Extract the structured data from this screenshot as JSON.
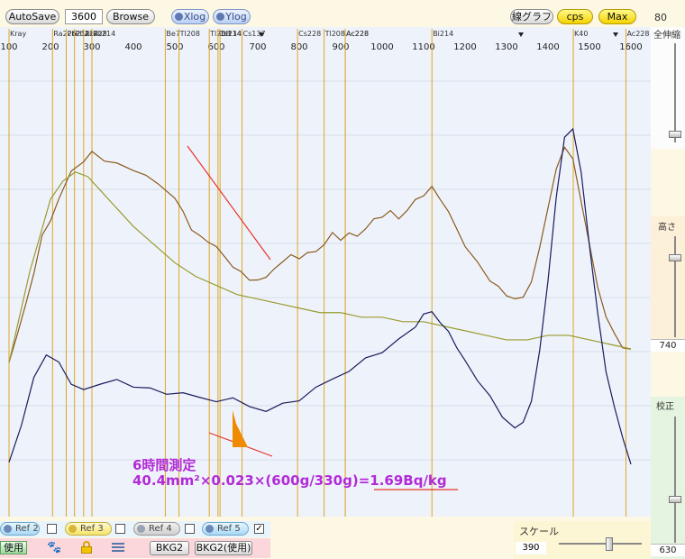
{
  "toolbar": {
    "autosave_label": "AutoSave",
    "measure_seconds": "3600",
    "browse_label": "Browse",
    "xlog_label": "Xlog",
    "ylog_label": "Ylog",
    "linear_graph_label": "線グラフ",
    "cps_label": "cps",
    "max_label": "Max",
    "max_value": "80"
  },
  "right_panel": {
    "zoom_all_label": "全伸縮",
    "height_label": "高さ",
    "height_value": "740",
    "calib_label": "校正",
    "calib_value": "630"
  },
  "bottom": {
    "ref2": "Ref 2",
    "ref3": "Ref 3",
    "ref4": "Ref 4",
    "ref5": "Ref 5",
    "ref5_checked": "✓",
    "use_label": "使用",
    "bkg2_label": "BKG2",
    "bkg2_use_label": "BKG2(使用)",
    "scale_label": "スケール",
    "scale_value": "390"
  },
  "chart_data": {
    "type": "line",
    "x_axis": {
      "min": 100,
      "max": 1600,
      "ticks": [
        100,
        200,
        300,
        400,
        500,
        600,
        700,
        800,
        900,
        1000,
        1100,
        1200,
        1300,
        1400,
        1500,
        1600
      ]
    },
    "nuclide_labels": [
      "Kray",
      "Ra226",
      "Pb212",
      "Pb214",
      "Ac228",
      "Pb214",
      "Be7",
      "Tl208",
      "Tl208",
      "Bi214",
      "Cs134",
      "Cs137",
      "Cs228",
      "Ac228",
      "Tl208",
      "Ac228",
      "Bi214",
      "K40",
      "Ac228"
    ],
    "series": [
      {
        "color": "#8b5a1e",
        "x": [
          100,
          120,
          140,
          160,
          180,
          200,
          220,
          250,
          280,
          300,
          330,
          360,
          400,
          430,
          460,
          500,
          520,
          540,
          560,
          580,
          600,
          620,
          640,
          660,
          680,
          700,
          720,
          740,
          760,
          780,
          800,
          820,
          840,
          860,
          880,
          900,
          920,
          940,
          960,
          980,
          1000,
          1020,
          1040,
          1060,
          1080,
          1100,
          1120,
          1140,
          1160,
          1180,
          1200,
          1230,
          1260,
          1280,
          1300,
          1320,
          1340,
          1360,
          1380,
          1400,
          1420,
          1440,
          1460,
          1480,
          1500,
          1520,
          1540,
          1560,
          1580,
          1600
        ],
        "y": [
          30,
          36,
          42,
          50,
          58,
          62,
          66,
          72,
          74,
          76,
          75,
          74,
          73,
          71,
          69,
          66,
          63,
          60,
          58,
          57,
          55,
          53,
          51,
          50,
          49,
          48,
          49,
          50,
          52,
          54,
          53,
          55,
          54,
          56,
          58,
          57,
          59,
          58,
          60,
          61,
          62,
          63,
          62,
          64,
          66,
          67,
          68,
          66,
          63,
          60,
          56,
          52,
          48,
          46,
          45,
          44,
          45,
          48,
          55,
          64,
          72,
          78,
          75,
          66,
          56,
          46,
          40,
          36,
          34,
          33
        ]
      },
      {
        "color": "#9a9a2e",
        "x": [
          100,
          150,
          200,
          230,
          260,
          290,
          320,
          360,
          400,
          450,
          500,
          550,
          600,
          650,
          700,
          750,
          800,
          850,
          900,
          950,
          1000,
          1050,
          1100,
          1150,
          1200,
          1250,
          1300,
          1350,
          1400,
          1450,
          1500,
          1550,
          1600
        ],
        "y": [
          30,
          50,
          66,
          70,
          72,
          71,
          68,
          64,
          60,
          56,
          52,
          49,
          47,
          45,
          44,
          43,
          42,
          41,
          41,
          40,
          40,
          39,
          39,
          38,
          37,
          36,
          35,
          35,
          36,
          36,
          35,
          34,
          33
        ]
      },
      {
        "color": "#1a1a5c",
        "x": [
          100,
          130,
          160,
          190,
          220,
          250,
          280,
          320,
          360,
          400,
          440,
          480,
          520,
          560,
          600,
          640,
          680,
          720,
          760,
          800,
          840,
          880,
          920,
          960,
          1000,
          1040,
          1080,
          1100,
          1120,
          1140,
          1160,
          1180,
          1200,
          1230,
          1260,
          1290,
          1320,
          1340,
          1360,
          1380,
          1400,
          1420,
          1440,
          1460,
          1480,
          1500,
          1520,
          1540,
          1560,
          1580,
          1600
        ],
        "y": [
          8,
          16,
          26,
          32,
          30,
          26,
          24,
          25,
          26,
          24,
          25,
          23,
          24,
          22,
          21,
          22,
          20,
          20,
          21,
          22,
          24,
          26,
          28,
          31,
          33,
          35,
          38,
          40,
          41,
          39,
          37,
          34,
          30,
          26,
          22,
          18,
          16,
          17,
          22,
          32,
          48,
          66,
          80,
          82,
          72,
          56,
          40,
          28,
          20,
          14,
          8
        ]
      }
    ],
    "annotations": [
      "6時間測定",
      "40.4mm²×0.023×(600g/330g)=1.69Bq/kg"
    ]
  }
}
